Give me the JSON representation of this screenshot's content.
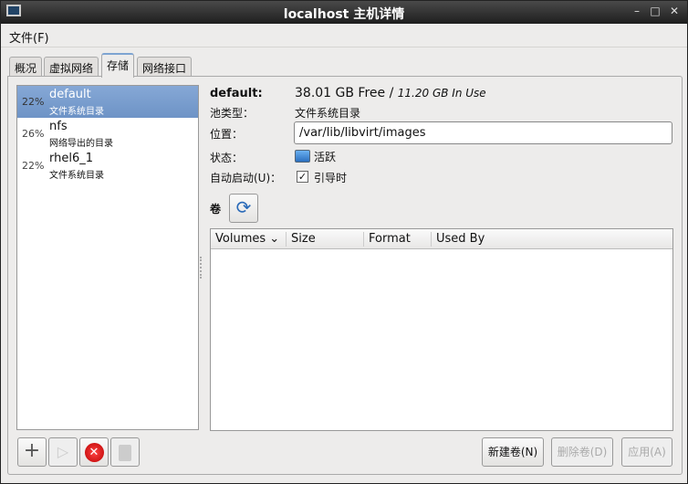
{
  "window": {
    "title": "localhost 主机详情",
    "min": "–",
    "max": "□",
    "close": "✕"
  },
  "menu": {
    "file": "文件(F)"
  },
  "tabs": [
    "概况",
    "虚拟网络",
    "存储",
    "网络接口"
  ],
  "pools": [
    {
      "percent": "22%",
      "name": "default",
      "type": "文件系统目录"
    },
    {
      "percent": "26%",
      "name": "nfs",
      "type": "网络导出的目录"
    },
    {
      "percent": "22%",
      "name": "rhel6_1",
      "type": "文件系统目录"
    }
  ],
  "details": {
    "name": "default:",
    "free": "38.01 GB Free",
    "sep": " / ",
    "in_use": "11.20 GB In Use",
    "type_label": "池类型：",
    "type_value": "文件系统目录",
    "location_label": "位置：",
    "location_value": "/var/lib/libvirt/images",
    "state_label": "状态：",
    "state_value": "活跃",
    "autostart_label": "自动启动(U)：",
    "autostart_value": "引导时",
    "autostart_checked": true,
    "volumes_label": "卷"
  },
  "volume_table": {
    "columns": [
      "Volumes",
      "Size",
      "Format",
      "Used By"
    ],
    "rows": []
  },
  "buttons": {
    "new_volume": "新建卷(N)",
    "delete_volume": "删除卷(D)",
    "apply": "应用(A)"
  }
}
